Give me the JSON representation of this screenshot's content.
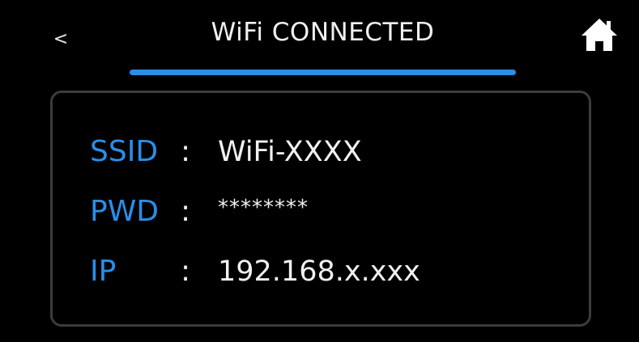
{
  "header": {
    "back_label": "<",
    "title": "WiFi CONNECTED",
    "home_icon": "home-icon"
  },
  "wifi": {
    "ssid_label": "SSID",
    "ssid_value": "WiFi-XXXX",
    "pwd_label": "PWD",
    "pwd_value": "********",
    "ip_label": "IP",
    "ip_value": "192.168.x.xxx",
    "separator": ":"
  },
  "colors": {
    "accent": "#2a8ee8",
    "background": "#000000",
    "text": "#f0f0f0",
    "card_border": "#3c3c3c"
  }
}
